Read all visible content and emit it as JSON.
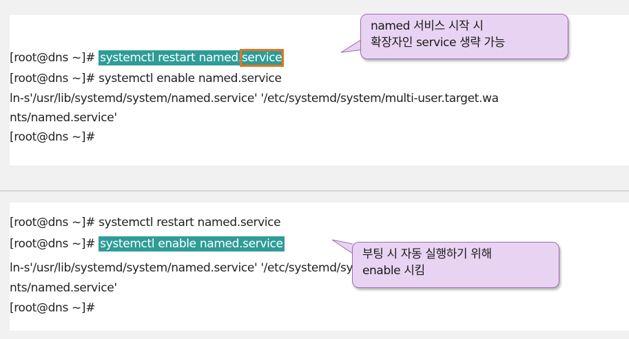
{
  "panel1": {
    "prompt": "[root@dns ~]# ",
    "lines": {
      "restart_cmd_main": "systemctl restart named.",
      "restart_cmd_ext": "service",
      "enable_line": "[root@dns ~]# systemctl enable named.service",
      "ln_line1": "ln-s'/usr/lib/systemd/system/named.service' '/etc/systemd/system/multi-user.target.wa",
      "ln_line2": "nts/named.service'",
      "last_prompt": "[root@dns ~]#"
    },
    "callout": {
      "line1": "named 서비스 시작 시",
      "line2": "확장자인 service 생략 가능"
    }
  },
  "panel2": {
    "restart_line": "[root@dns ~]# systemctl restart named.service",
    "prompt": "[root@dns ~]# ",
    "enable_cmd": "systemctl enable named.service",
    "ln_line1": "ln-s'/usr/lib/systemd/system/named.service' '/etc/systemd/system/multi-user.target.wa",
    "ln_line2": "nts/named.service'",
    "last_prompt": "[root@dns ~]#",
    "callout": {
      "line1": "부팅 시 자동 실행하기 위해",
      "line2": "enable 시킴"
    }
  },
  "colors": {
    "highlight": "#2e9c97",
    "ext_box": "#e5741f",
    "callout_bg": "#e9d3f2",
    "callout_border": "#9b6bb0"
  }
}
